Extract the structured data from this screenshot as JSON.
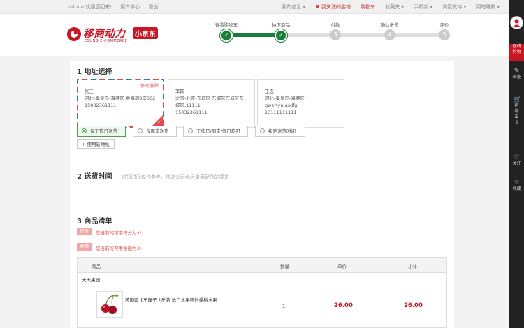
{
  "topbar": {
    "user": "admin 欢迎您回来!",
    "links": [
      "用户中心",
      "退出"
    ],
    "right_links": [
      "我的信息 ▾",
      "♥ 我关注的店铺",
      "购物车",
      "收藏夹 ▾",
      "手机新 ▾",
      "商家支持 ▾",
      "网站导航 ▾"
    ]
  },
  "logo": {
    "brand_cn": "移商动力",
    "brand_tag": "小京东",
    "brand_en": "ESUNG E-COMMERCE"
  },
  "steps": [
    {
      "label": "查看购物车",
      "num": "✓",
      "done": true
    },
    {
      "label": "拍下商品",
      "num": "✓",
      "done": true
    },
    {
      "label": "付款",
      "num": "3",
      "done": false
    },
    {
      "label": "确认收货",
      "num": "4",
      "done": false
    },
    {
      "label": "评价",
      "num": "5",
      "done": false
    }
  ],
  "address": {
    "title": "1 地址选择",
    "cards": [
      {
        "name": "张三",
        "addr": "河北-秦皇岛-海港区 金海湾8座302",
        "phone": "15032361111",
        "ops": "修改 删除"
      },
      {
        "name": "李四",
        "addr": "北京-北京-东城区 东城区东城区东城区,11111",
        "phone": "15032361111"
      },
      {
        "name": "王五",
        "addr": "河北-秦皇岛-海港区 qwertyu,asdfg",
        "phone": "13111111111"
      }
    ],
    "new_button": "+ 使用新地址"
  },
  "delivery": {
    "title": "2 送货时间",
    "hint": "送货时间仅作参考，快递公司会尽量满足您的要求",
    "options": [
      "仅工作日送货",
      "仅周末送货",
      "工作日/周末/假日均可",
      "指定送货时间"
    ]
  },
  "goods": {
    "title": "3 商品清单",
    "points_tag": "积分",
    "points_text": "您当前的可用积分为:0",
    "balance_tag": "余额",
    "balance_text": "您当前的可用余额为:0",
    "headers": [
      "商品",
      "数量",
      "单价",
      "小计"
    ],
    "shop": "天天果园",
    "item": {
      "name": "美国西北车厘子 1斤装 进口水果新鲜樱桃水果",
      "qty": "1",
      "price": "26.00",
      "subtotal": "26.00"
    }
  },
  "sidebar": {
    "online": "在线购物",
    "items": [
      {
        "label": "调查",
        "icon": "✎"
      },
      {
        "label": "购物车",
        "icon": "🛒",
        "count": "2"
      },
      {
        "label": "关注",
        "icon": "♡"
      },
      {
        "label": "收藏",
        "icon": "☆"
      }
    ]
  },
  "colors": {
    "accent": "#c81624",
    "done_green": "#1b7d3a"
  }
}
